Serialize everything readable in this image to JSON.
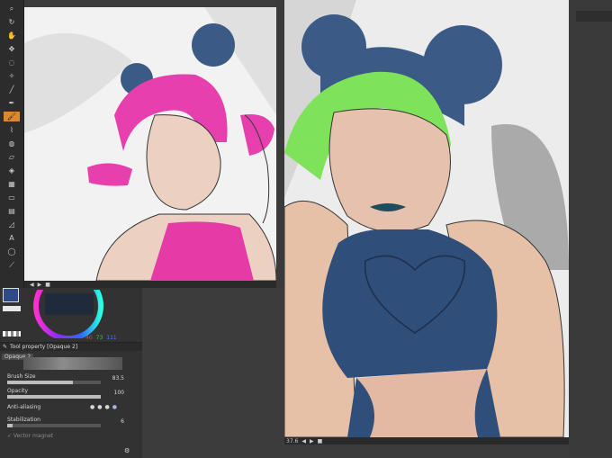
{
  "tools": [
    {
      "icon": "zoom-icon",
      "glyph": "⌕"
    },
    {
      "icon": "rotate-icon",
      "glyph": "↻"
    },
    {
      "icon": "hand-icon",
      "glyph": "✋"
    },
    {
      "icon": "move-icon",
      "glyph": "✥"
    },
    {
      "icon": "lasso-icon",
      "glyph": "◌"
    },
    {
      "icon": "magic-wand-icon",
      "glyph": "✧"
    },
    {
      "icon": "eyedropper-icon",
      "glyph": "╱"
    },
    {
      "icon": "pen-icon",
      "glyph": "✒"
    },
    {
      "icon": "brush-icon",
      "glyph": "🖌",
      "active": true
    },
    {
      "icon": "airbrush-icon",
      "glyph": "⌇"
    },
    {
      "icon": "blend-icon",
      "glyph": "◍"
    },
    {
      "icon": "eraser-icon",
      "glyph": "▱"
    },
    {
      "icon": "fill-icon",
      "glyph": "◈"
    },
    {
      "icon": "gradient-icon",
      "glyph": "▦"
    },
    {
      "icon": "figure-icon",
      "glyph": "▭"
    },
    {
      "icon": "frame-icon",
      "glyph": "▤"
    },
    {
      "icon": "ruler-icon",
      "glyph": "◿"
    },
    {
      "icon": "text-icon",
      "glyph": "A"
    },
    {
      "icon": "balloon-icon",
      "glyph": "◯"
    },
    {
      "icon": "correct-line-icon",
      "glyph": "⟋"
    }
  ],
  "colors": {
    "main": "#2d4a86",
    "sub": "#ffffff",
    "accent_tool": "#d98a2b",
    "hair_left": "#e83fae",
    "hair_right": "#7ee35a",
    "buns": "#3b5a86",
    "top": "#2f4e7a",
    "skin": "#e9c9b8"
  },
  "color_values": {
    "r": "40",
    "g": "73",
    "b": "111"
  },
  "tool_property": {
    "header": "Tool property [Opaque 2]",
    "sub_tool_name": "Opaque 2",
    "brush_size_label": "Brush Size",
    "brush_size_value": "83.5",
    "opacity_label": "Opacity",
    "opacity_value": "100",
    "antialias_label": "Anti-aliasing",
    "stabilization_label": "Stabilization",
    "stabilization_value": "6",
    "vector_magnet_label": "Vector magnet"
  },
  "status": {
    "left_zoom": "",
    "right_zoom": "37.6"
  },
  "levels": {
    "brush_size": 0.7,
    "opacity": 1.0,
    "stabilization": 0.06
  }
}
